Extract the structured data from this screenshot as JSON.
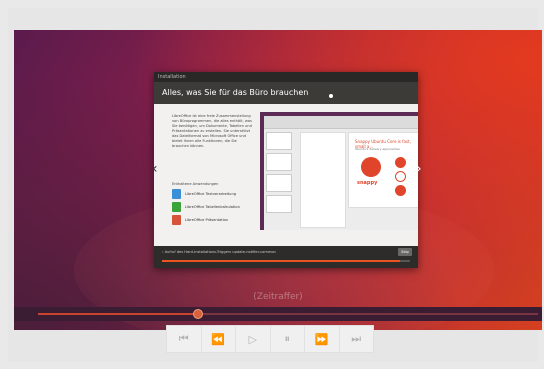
{
  "installer": {
    "window_title": "Installation",
    "header": "Alles, was Sie für das Büro brauchen",
    "description": "LibreOffice ist eine freie Zusammenstellung von Büroprogrammen, die alles enthält, was Sie benötigen, um Dokumente, Tabellen und Präsentationen zu erstellen. Sie unterstützt das Dateiformat von Microsoft Office und bietet Ihnen alle Funktionen, die Sie brauchen können.",
    "apps_title": "Enthaltene Anwendungen",
    "apps": [
      {
        "label": "LibreOffice Textverarbeitung",
        "color": "#3a8fd6"
      },
      {
        "label": "LibreOffice Tabellenkalkulation",
        "color": "#3aa33a"
      },
      {
        "label": "LibreOffice Präsentation",
        "color": "#d6543a"
      }
    ],
    "slide": {
      "title": "Snappy Ubuntu Core is fast, small a...",
      "subtitle": "Ubuntu's delivery approaches",
      "logo_text": "snappy"
    },
    "status_text": "› Aufruf des Hard-Installations-Triggers update-notifier-common",
    "skip_label": "Skip",
    "progress": 0.96
  },
  "player": {
    "caption": "(Zeitraffer)",
    "seek_position": 0.32,
    "controls": [
      {
        "name": "skip-to-start",
        "glyph": "⏮"
      },
      {
        "name": "rewind",
        "glyph": "⏪"
      },
      {
        "name": "play",
        "glyph": "▷"
      },
      {
        "name": "pause",
        "glyph": "⏸"
      },
      {
        "name": "fast-forward",
        "glyph": "⏩"
      },
      {
        "name": "skip-to-end",
        "glyph": "⏭"
      }
    ]
  },
  "colors": {
    "accent": "#e95420",
    "seek_fill": "#c8442d"
  }
}
